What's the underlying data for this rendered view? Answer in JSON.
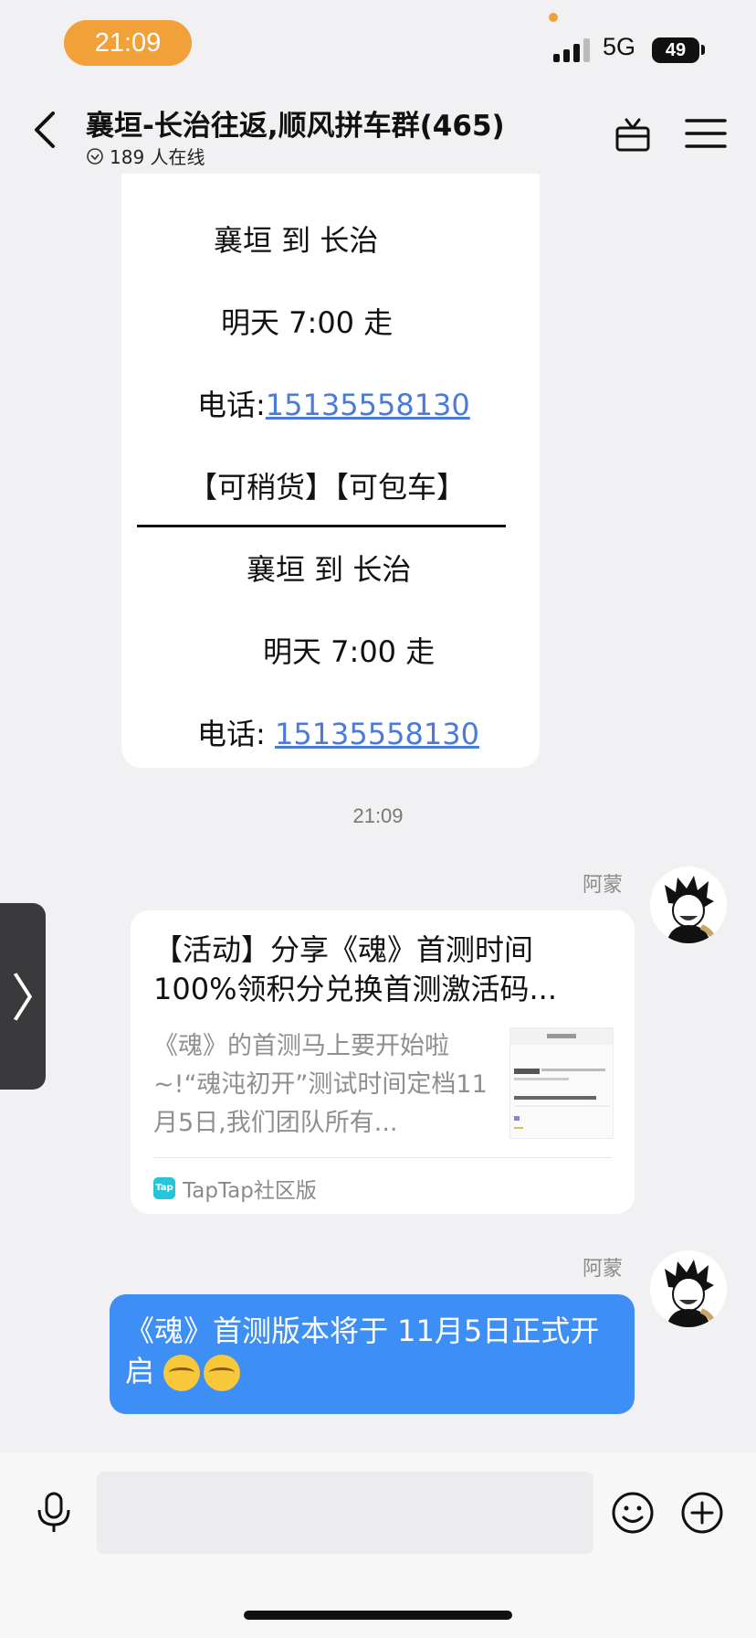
{
  "status_bar": {
    "time": "21:09",
    "network": "5G",
    "battery": "49"
  },
  "header": {
    "title": "襄垣-长治往返,顺风拼车群(465)",
    "online": "189 人在线",
    "icons": [
      "chevron-left-icon",
      "gift-icon",
      "menu-icon"
    ]
  },
  "upper_card": {
    "lines": [
      "襄垣 到 长治",
      "明天 7:00 走",
      "电话:",
      "15135558130",
      "【可稍货】【可包车】",
      "襄垣  到  长治",
      "明天 7:00 走",
      "电话:",
      "15135558130"
    ]
  },
  "timestamp": "21:09",
  "messages": [
    {
      "sender": "阿蒙",
      "type": "link_card",
      "title": "【活动】分享《魂》首测时间100%领积分兑换首测激活码...",
      "description": "《魂》的首测马上要开始啦~!“魂沌初开”测试时间定档11月5日,我们团队所有...",
      "source": "TapTap社区版",
      "source_icon_text": "Tap"
    },
    {
      "sender": "阿蒙",
      "type": "text",
      "text": "《魂》首测版本将于 11月5日正式开启",
      "emojis": [
        "face-emoji",
        "face-emoji"
      ]
    }
  ],
  "input_bar": {
    "placeholder": "",
    "icons": [
      "microphone-icon",
      "smiley-icon",
      "plus-circle-icon"
    ]
  },
  "colors": {
    "accent_blue": "#3d8ef5",
    "time_pill": "#f0a13a",
    "link": "#4a7bd9"
  }
}
